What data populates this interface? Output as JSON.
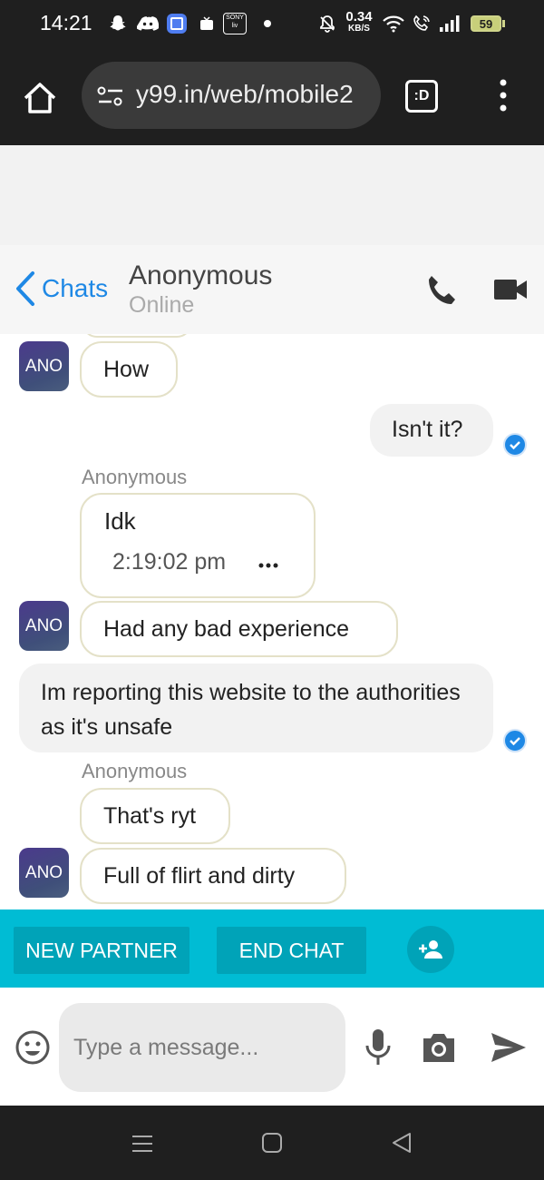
{
  "status_bar": {
    "time": "14:21",
    "speed_value": "0.34",
    "speed_unit": "KB/S",
    "battery": "59"
  },
  "browser": {
    "url": "y99.in/web/mobile2",
    "tab_switcher_label": ":D"
  },
  "chat_header": {
    "back_label": "Chats",
    "partner_name": "Anonymous",
    "partner_status": "Online"
  },
  "messages": [
    {
      "side": "in",
      "text": "How",
      "avatar": "ANO"
    },
    {
      "side": "out",
      "text": "Isn't it?"
    },
    {
      "side": "in",
      "sender": "Anonymous",
      "text": "Idk",
      "time": "2:19:02 pm"
    },
    {
      "side": "in",
      "text": "Had any bad experience",
      "avatar": "ANO"
    },
    {
      "side": "out",
      "text": "Im reporting this website to the authorities as it's unsafe"
    },
    {
      "side": "in",
      "sender": "Anonymous",
      "text": "That's ryt"
    },
    {
      "side": "in",
      "text": "Full of flirt and dirty",
      "avatar": "ANO"
    }
  ],
  "actions": {
    "new_partner": "NEW PARTNER",
    "end_chat": "END CHAT"
  },
  "composer": {
    "placeholder": "Type a message..."
  },
  "colors": {
    "accent_teal": "#00bcd4",
    "button_teal": "#00a3b8",
    "link_blue": "#1e88e5",
    "bubble_border": "#e4e1c8"
  }
}
